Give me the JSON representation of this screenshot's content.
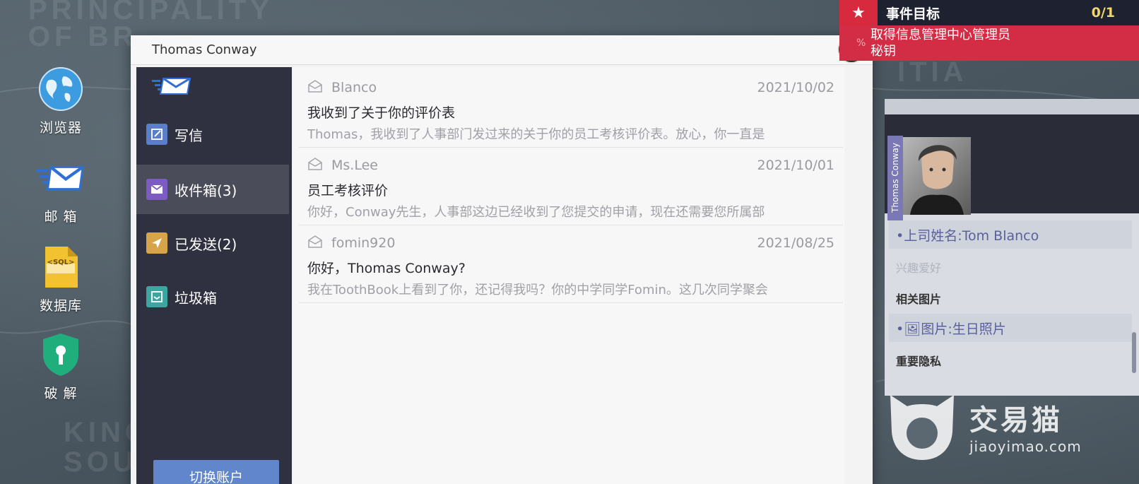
{
  "background": {
    "map_labels": [
      "PRINCIPALITY",
      "OF BR",
      "KING",
      "SOUT",
      "ITIA"
    ]
  },
  "desktop": {
    "icons": [
      {
        "name": "browser",
        "label": "浏览器"
      },
      {
        "name": "mail",
        "label": "邮 箱"
      },
      {
        "name": "database",
        "label": "数据库"
      },
      {
        "name": "crack",
        "label": "破 解"
      }
    ],
    "database_badge": "<SQL>"
  },
  "mail_window": {
    "title": "Thomas Conway",
    "close_symbol": "✕",
    "sidebar": {
      "items": [
        {
          "label": "写信",
          "icon": "compose-icon",
          "color": "#5b7ec9"
        },
        {
          "label": "收件箱(3)",
          "icon": "inbox-icon",
          "color": "#7c5cc2",
          "active": true
        },
        {
          "label": "已发送(2)",
          "icon": "sent-icon",
          "color": "#d7a44a"
        },
        {
          "label": "垃圾箱",
          "icon": "trash-icon",
          "color": "#3ea6a0"
        }
      ],
      "switch_account_label": "切换账户"
    },
    "messages": [
      {
        "sender": "Blanco",
        "date": "2021/10/02",
        "subject": "我收到了关于你的评价表",
        "preview": "Thomas，我收到了人事部门发过来的关于你的员工考核评价表。放心，你一直是"
      },
      {
        "sender": "Ms.Lee",
        "date": "2021/10/01",
        "subject": "员工考核评价",
        "preview": "你好，Conway先生，人事部这边已经收到了您提交的申请，现在还需要您所属部"
      },
      {
        "sender": "fomin920",
        "date": "2021/08/25",
        "subject": "你好，Thomas Conway?",
        "preview": "我在ToothBook上看到了你，还记得我吗？你的中学同学Fomin。这几次同学聚会"
      }
    ]
  },
  "objective": {
    "title": "事件目标",
    "count": "0/1",
    "pct_symbol": "%",
    "text_line1": "取得信息管理中心管理员",
    "text_line2": "秘钥",
    "accent_color": "#d22d45"
  },
  "profile": {
    "name_tag": "Thomas Conway",
    "supervisor": "•上司姓名:Tom Blanco",
    "hobby_label": "兴趣爱好",
    "related_images_label": "相关图片",
    "image_item": "•🖼图片:生日照片",
    "privacy_label": "重要隐私"
  },
  "watermark": {
    "cn": "交易猫",
    "en": "jiaoyimao.com"
  }
}
